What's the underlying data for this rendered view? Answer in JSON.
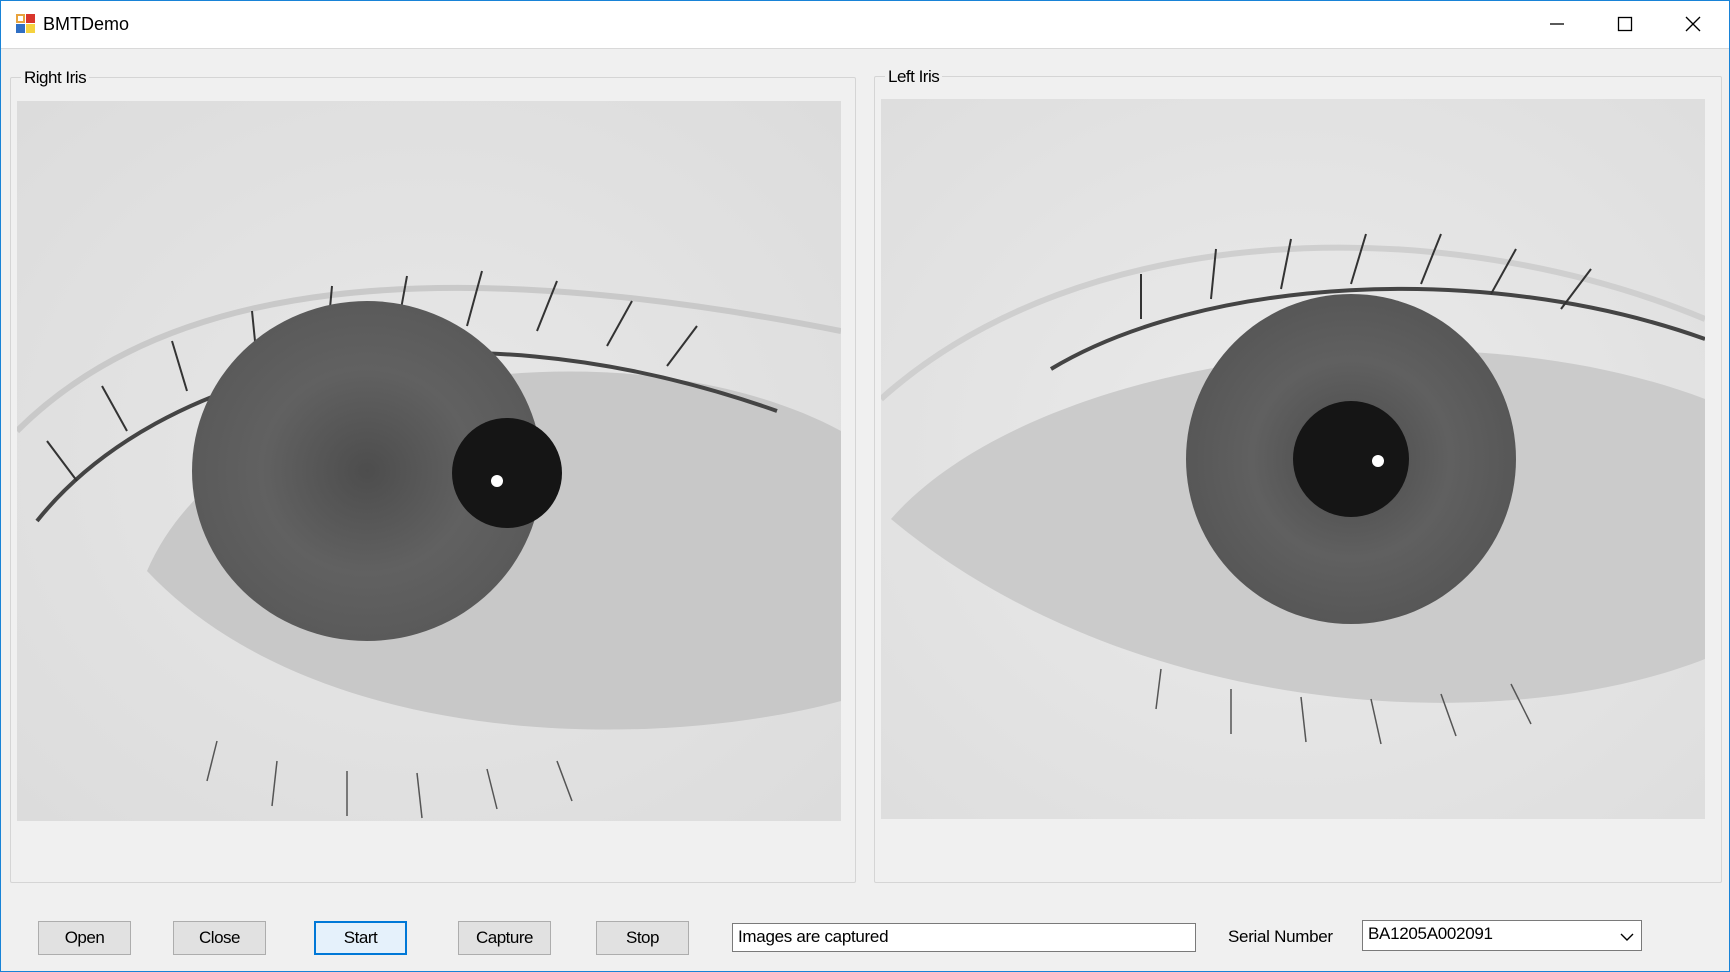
{
  "window": {
    "title": "BMTDemo",
    "controls": {
      "minimize": "minimize",
      "maximize": "maximize",
      "close": "close"
    }
  },
  "panels": {
    "right": {
      "label": "Right Iris"
    },
    "left": {
      "label": "Left Iris"
    }
  },
  "toolbar": {
    "open_label": "Open",
    "close_label": "Close",
    "start_label": "Start",
    "capture_label": "Capture",
    "stop_label": "Stop"
  },
  "status": {
    "value": "Images are captured"
  },
  "serial": {
    "label": "Serial Number",
    "selected": "BA1205A002091"
  },
  "icons": {
    "app": "app-icon",
    "minimize": "minimize-icon",
    "maximize": "maximize-icon",
    "close": "close-icon",
    "dropdown": "chevron-down-icon"
  },
  "colors": {
    "accent": "#0078d7",
    "window_border": "#1883d7"
  }
}
